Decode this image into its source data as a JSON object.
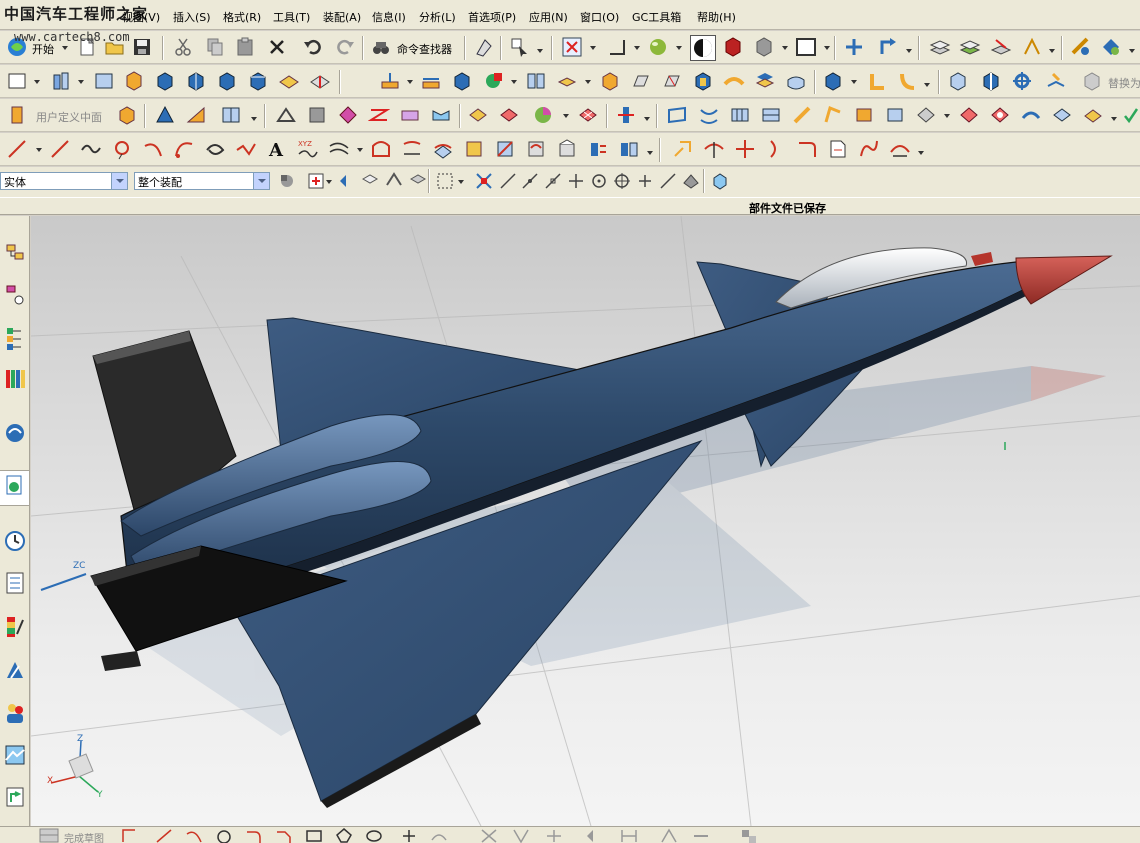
{
  "watermark": {
    "site_name": "中国汽车工程师之家",
    "url": "www.cartech8.com"
  },
  "menu": {
    "items": [
      {
        "label": "视图(V)"
      },
      {
        "label": "插入(S)"
      },
      {
        "label": "格式(R)"
      },
      {
        "label": "工具(T)"
      },
      {
        "label": "装配(A)"
      },
      {
        "label": "信息(I)"
      },
      {
        "label": "分析(L)"
      },
      {
        "label": "首选项(P)"
      },
      {
        "label": "应用(N)"
      },
      {
        "label": "窗口(O)"
      },
      {
        "label": "GC工具箱"
      },
      {
        "label": "帮助(H)"
      }
    ]
  },
  "toolbar": {
    "start_label": "开始",
    "command_finder_label": "命令查找器",
    "user_defined_label": "用户定义中面",
    "replace_label": "替换为"
  },
  "selection": {
    "type_filter_value": "实体",
    "scope_value": "整个装配"
  },
  "status": {
    "message": "部件文件已保存"
  },
  "viewport": {
    "axis_label_zc": "ZC",
    "triad_labels": {
      "z": "Z",
      "x": "X",
      "y": "Y"
    }
  },
  "bottom": {
    "finish_sketch_label": "完成草图"
  },
  "colors": {
    "fuselage": "#2e4a6b",
    "nose_cone": "#b5352c",
    "canopy": "#d8dde2",
    "tail_dark": "#2a2a2a"
  }
}
